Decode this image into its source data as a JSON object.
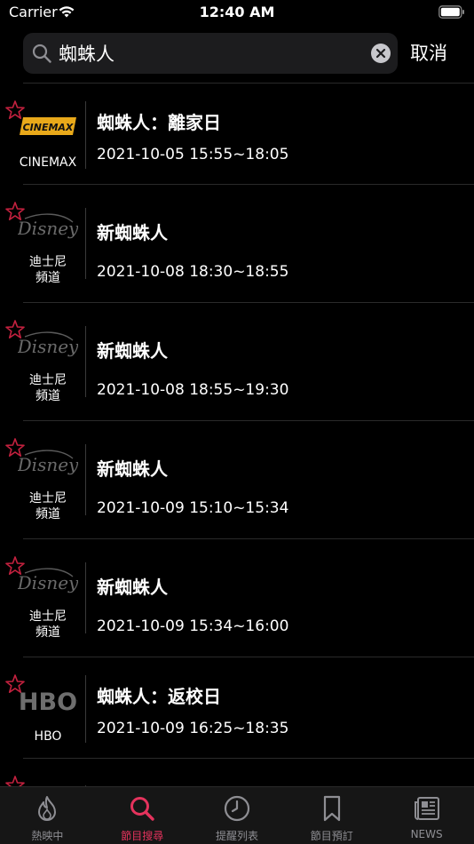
{
  "status_bar": {
    "carrier": "Carrier",
    "time": "12:40 AM"
  },
  "search": {
    "value": "蜘蛛人",
    "placeholder": "",
    "cancel_label": "取消"
  },
  "results": [
    {
      "channel": "CINEMAX",
      "logo": "cinemax-logo",
      "title": "蜘蛛人：離家日",
      "time": "2021-10-05 15:55~18:05"
    },
    {
      "channel": "迪士尼頻道",
      "logo": "disney-logo",
      "title": "新蜘蛛人",
      "time": "2021-10-08 18:30~18:55"
    },
    {
      "channel": "迪士尼頻道",
      "logo": "disney-logo",
      "title": "新蜘蛛人",
      "time": "2021-10-08 18:55~19:30"
    },
    {
      "channel": "迪士尼頻道",
      "logo": "disney-logo",
      "title": "新蜘蛛人",
      "time": "2021-10-09 15:10~15:34"
    },
    {
      "channel": "迪士尼頻道",
      "logo": "disney-logo",
      "title": "新蜘蛛人",
      "time": "2021-10-09 15:34~16:00"
    },
    {
      "channel": "HBO",
      "logo": "hbo-logo",
      "title": "蜘蛛人：返校日",
      "time": "2021-10-09 16:25~18:35"
    }
  ],
  "tabs": [
    {
      "label": "熱映中",
      "icon": "flame-icon"
    },
    {
      "label": "節目搜尋",
      "icon": "search-icon",
      "active": true
    },
    {
      "label": "提醒列表",
      "icon": "clock-icon"
    },
    {
      "label": "節目預訂",
      "icon": "bookmark-icon"
    },
    {
      "label": "NEWS",
      "icon": "newspaper-icon"
    }
  ],
  "colors": {
    "accent": "#e5335d",
    "star": "#c4213f",
    "background": "#000000",
    "search_bg": "#1c1c1e"
  }
}
